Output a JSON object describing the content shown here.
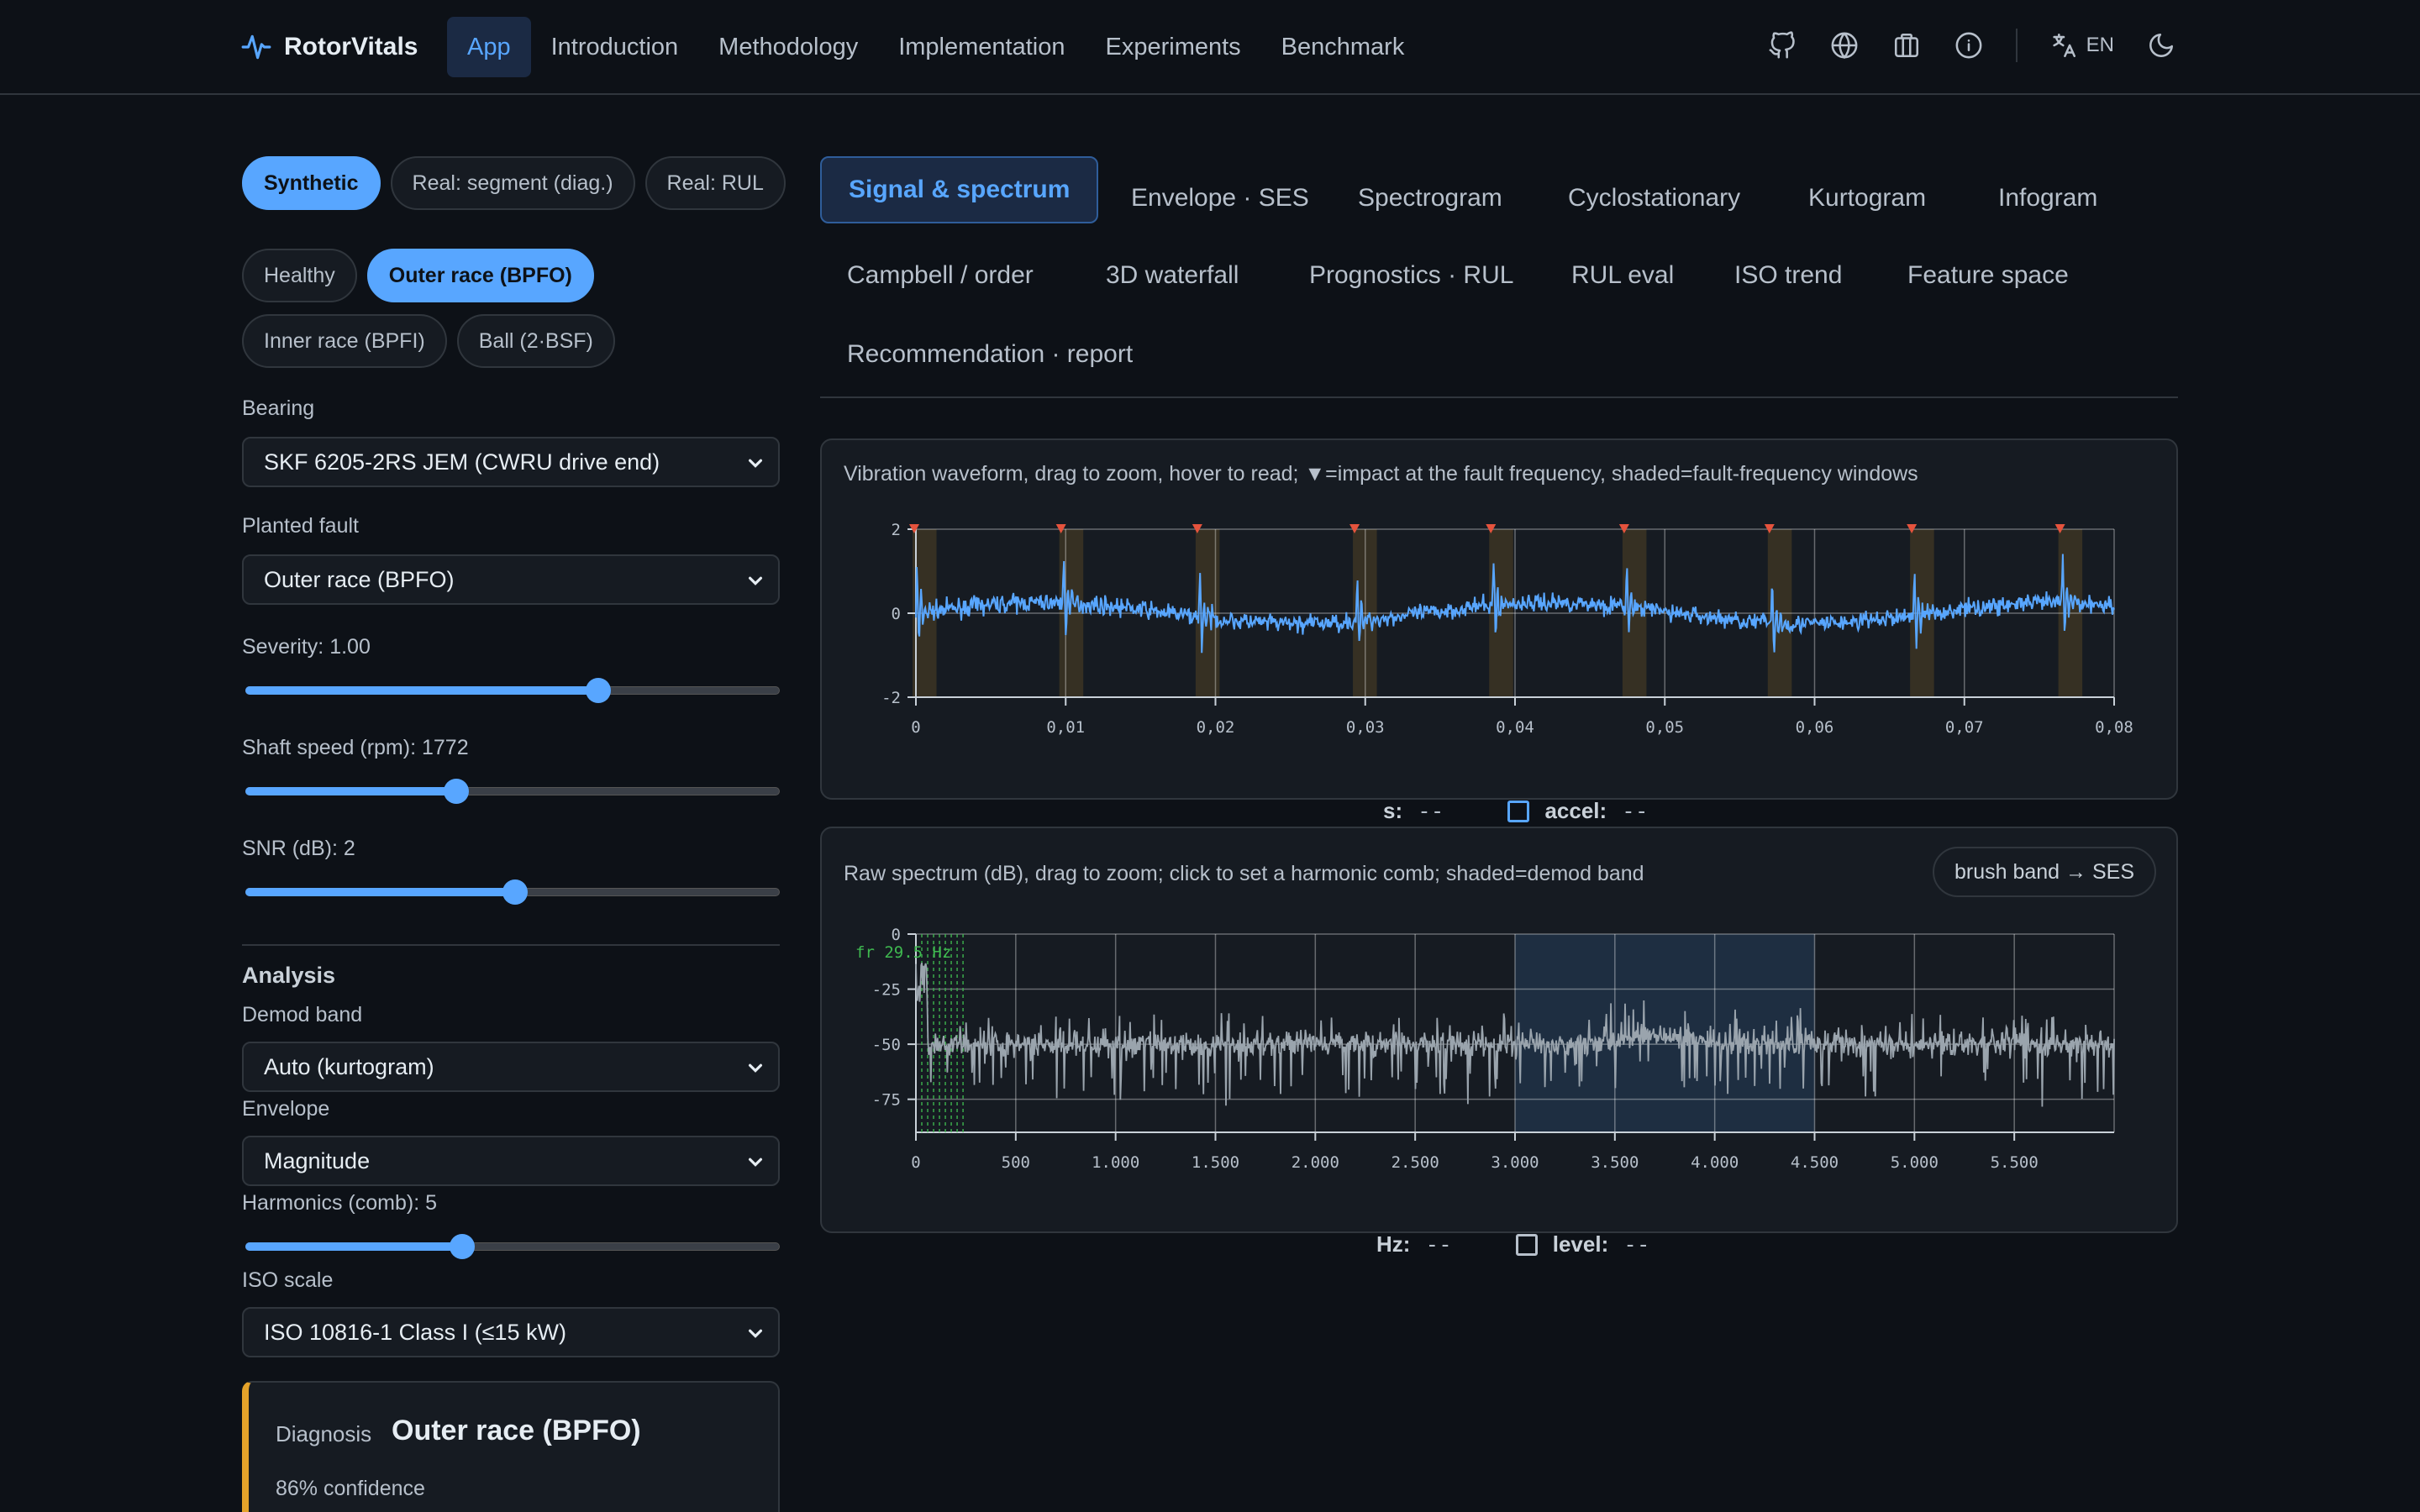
{
  "nav": {
    "brand": "RotorVitals",
    "links": [
      "App",
      "Introduction",
      "Methodology",
      "Implementation",
      "Experiments",
      "Benchmark"
    ],
    "active": 0,
    "icons": [
      "github-icon",
      "globe-icon",
      "briefcase-icon",
      "info-icon"
    ],
    "lang": "EN"
  },
  "sidebar": {
    "source_modes": [
      "Synthetic",
      "Real: segment (diag.)",
      "Real: RUL"
    ],
    "source_active": 0,
    "fault_modes": [
      "Healthy",
      "Outer race (BPFO)",
      "Inner race (BPFI)",
      "Ball (2·BSF)"
    ],
    "fault_active": 1,
    "bearing_label": "Bearing",
    "bearing_value": "SKF 6205-2RS JEM (CWRU drive end)",
    "planted_label": "Planted fault",
    "planted_value": "Outer race (BPFO)",
    "severity_label": "Severity: 1.00",
    "severity_fraction": 0.66,
    "speed_label": "Shaft speed (rpm): 1772",
    "speed_fraction": 0.395,
    "snr_label": "SNR (dB): 2",
    "snr_fraction": 0.505,
    "analysis_title": "Analysis",
    "demod_label": "Demod band",
    "demod_value": "Auto (kurtogram)",
    "envelope_label": "Envelope",
    "envelope_value": "Magnitude",
    "harmonics_label": "Harmonics (comb): 5",
    "harmonics_fraction": 0.405,
    "iso_label": "ISO scale",
    "iso_value": "ISO 10816-1 Class I (≤15 kW)",
    "diagnosis_label": "Diagnosis",
    "diagnosis_value": "Outer race (BPFO)",
    "confidence": "86% confidence"
  },
  "tabs": {
    "items": [
      "Signal & spectrum",
      "Envelope · SES",
      "Spectrogram",
      "Cyclostationary",
      "Kurtogram",
      "Infogram",
      "Campbell / order",
      "3D waterfall",
      "Prognostics · RUL",
      "RUL eval",
      "ISO trend",
      "Feature space",
      "Recommendation · report"
    ],
    "active": 0
  },
  "waveform_panel": {
    "caption": "Vibration waveform, drag to zoom, hover to read; ▼=impact at the fault frequency, shaded=fault-frequency windows",
    "readout_x_label": "s:",
    "readout_x_value": "--",
    "readout_y_label": "accel:",
    "readout_y_value": "--"
  },
  "spectrum_panel": {
    "caption": "Raw spectrum (dB), drag to zoom; click to set a harmonic comb; shaded=demod band",
    "brush_button": "brush band → SES",
    "annotation": "fr 29.5 Hz",
    "readout_x_label": "Hz:",
    "readout_x_value": "--",
    "readout_y_label": "level:",
    "readout_y_value": "--"
  },
  "chart_data": [
    {
      "type": "line",
      "title": "",
      "x_ticks": [
        "0",
        "0,01",
        "0,02",
        "0,03",
        "0,04",
        "0,05",
        "0,06",
        "0,07",
        "0,08"
      ],
      "y_ticks": [
        "2",
        "0",
        "-2"
      ],
      "xlim": [
        0,
        0.08
      ],
      "ylim": [
        -2,
        2
      ],
      "impacts_s": [
        0.0,
        0.0098,
        0.0189,
        0.0294,
        0.0385,
        0.0474,
        0.0571,
        0.0666,
        0.0765
      ],
      "fault_window_s": 0.0016,
      "series": [
        {
          "color": "#58a6ff"
        }
      ]
    },
    {
      "type": "line",
      "title": "",
      "x_ticks": [
        "0",
        "500",
        "1.000",
        "1.500",
        "2.000",
        "2.500",
        "3.000",
        "3.500",
        "4.000",
        "4.500",
        "5.000",
        "5.500"
      ],
      "y_ticks": [
        "0",
        "-25",
        "-50",
        "-75"
      ],
      "xlim": [
        0,
        6000
      ],
      "ylim": [
        -90,
        0
      ],
      "demod_band_hz": [
        3000,
        4500
      ],
      "fr_hz": 29.5,
      "series": [
        {
          "color": "#9aa4ad"
        }
      ]
    }
  ]
}
